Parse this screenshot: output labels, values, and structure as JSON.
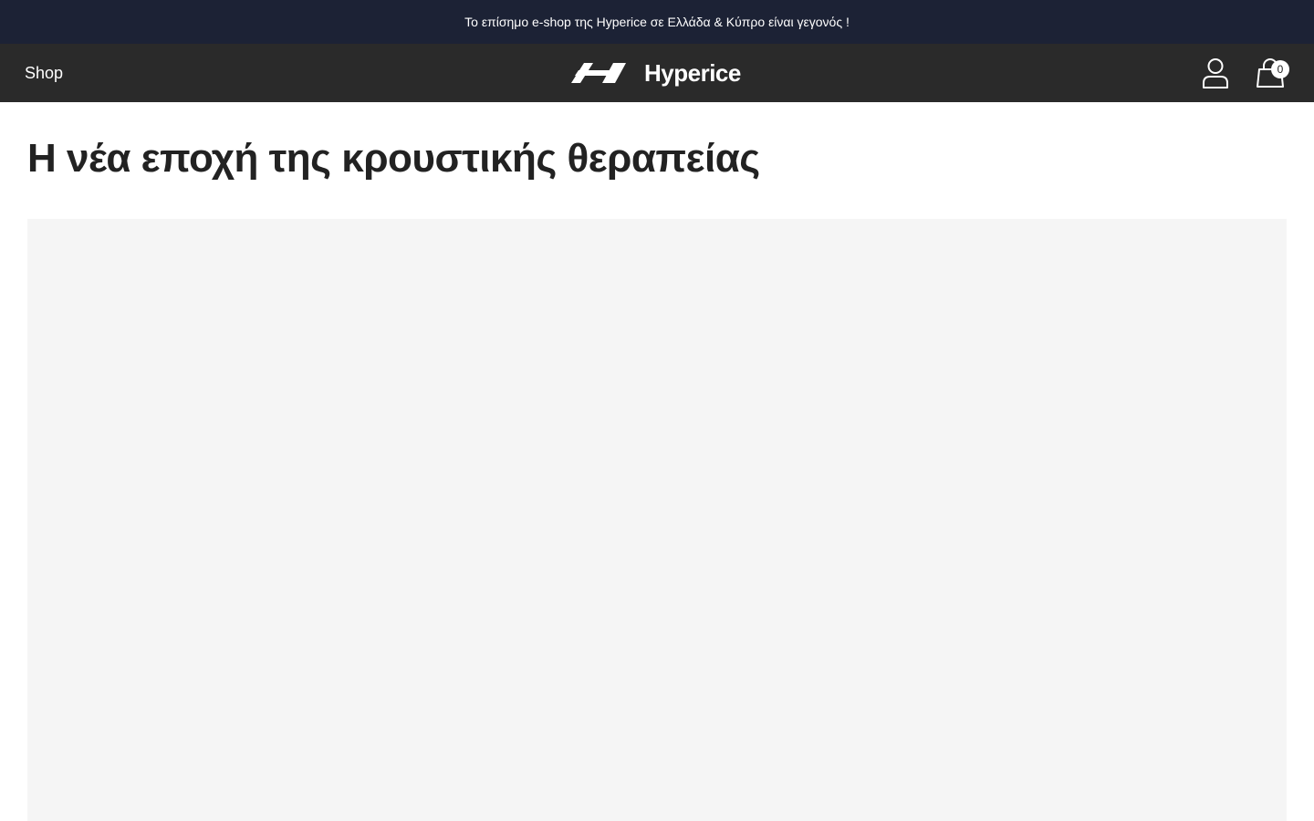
{
  "announcement": {
    "text": "Το επίσημο e-shop της Hyperice σε Ελλάδα & Κύπρο είναι γεγονός !"
  },
  "header": {
    "nav_shop_label": "Shop",
    "brand_name": "Hyperice",
    "logo_icon": "hyperice-logo-icon",
    "account_icon": "user-icon",
    "cart_icon": "shopping-bag-icon",
    "cart_count": "0"
  },
  "main": {
    "title": "Η νέα εποχή της κρουστικής θεραπείας"
  },
  "colors": {
    "announcement_bg": "#1c2235",
    "header_bg": "#2a2a2a",
    "title_text": "#222222",
    "media_placeholder_bg": "#f5f5f5"
  }
}
